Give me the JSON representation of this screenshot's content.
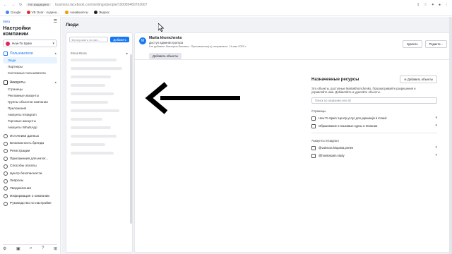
{
  "browser": {
    "secure_label": "Не защищено",
    "url": "business.facebook.com/settings/people/100089469762667",
    "bookmarks": [
      {
        "label": "Google",
        "color": "#4285f4"
      },
      {
        "label": "VB Ovar - подача...",
        "color": "#d93025"
      },
      {
        "label": "AvиaБилеты",
        "color": "#f29900"
      },
      {
        "label": "Яндекс",
        "color": "#202124"
      }
    ]
  },
  "sidebar": {
    "brand": "Meta",
    "title": "Настройки компании",
    "company": "How-To Spain",
    "sections": [
      {
        "label": "Пользователи",
        "active": true,
        "items": [
          {
            "label": "Люди",
            "active": true
          },
          {
            "label": "Партнеры",
            "active": false
          },
          {
            "label": "Системные пользователи",
            "active": false
          }
        ]
      },
      {
        "label": "Аккаунты",
        "active": false,
        "items": [
          {
            "label": "Страницы",
            "active": false
          },
          {
            "label": "Рекламные аккаунты",
            "active": false
          },
          {
            "label": "Группы объектов компании",
            "active": false
          },
          {
            "label": "Приложения",
            "active": false
          },
          {
            "label": "Аккаунты Instagram",
            "active": false
          },
          {
            "label": "Торговые аккаунты",
            "active": false
          },
          {
            "label": "Аккаунты WhatsApp",
            "active": false
          }
        ]
      }
    ],
    "bottom": [
      "Источники данных",
      "Безопасность бренда",
      "Регистрации",
      "Приложения для интег...",
      "Способы оплаты",
      "Центр безопасности",
      "Запросы",
      "Уведомления",
      "Информация о компании",
      "Руководство по настройке"
    ]
  },
  "main": {
    "page_title": "Люди",
    "filter_placeholder": "Фильтровать по име...",
    "add_button": "Добавить",
    "list_header_name": "Elena Brera",
    "user": {
      "initial": "M",
      "name": "Mariia khomchenko",
      "role": "Доступ администратора",
      "meta": "Кто добавил: Виктория Белкина · Приглашение(-я) отправлено: 14 мая 2023 г.",
      "add_objects": "Добавить объекты",
      "delete": "Удалить",
      "edit": "Редакти..."
    },
    "assigned": {
      "title": "Назначенные ресурсы",
      "add_button": "Добавить объекты",
      "description": "Это объекты, доступные Mariiakhomchenko. Просматривайте разрешения и управляйте ими. Добавляйте и удаляйте объекты.",
      "search_placeholder": "Поиск по названию или ID",
      "group_pages": "Страницы",
      "pages": [
        "How To Spain: Центр услуг для украинців в Іспанії",
        "Образование и языковые курсы в Испании"
      ],
      "group_instagram": "Аккаунты Instagram",
      "instagram": [
        "@valencia.hispania.pertes",
        "@howtospain.study"
      ]
    }
  }
}
